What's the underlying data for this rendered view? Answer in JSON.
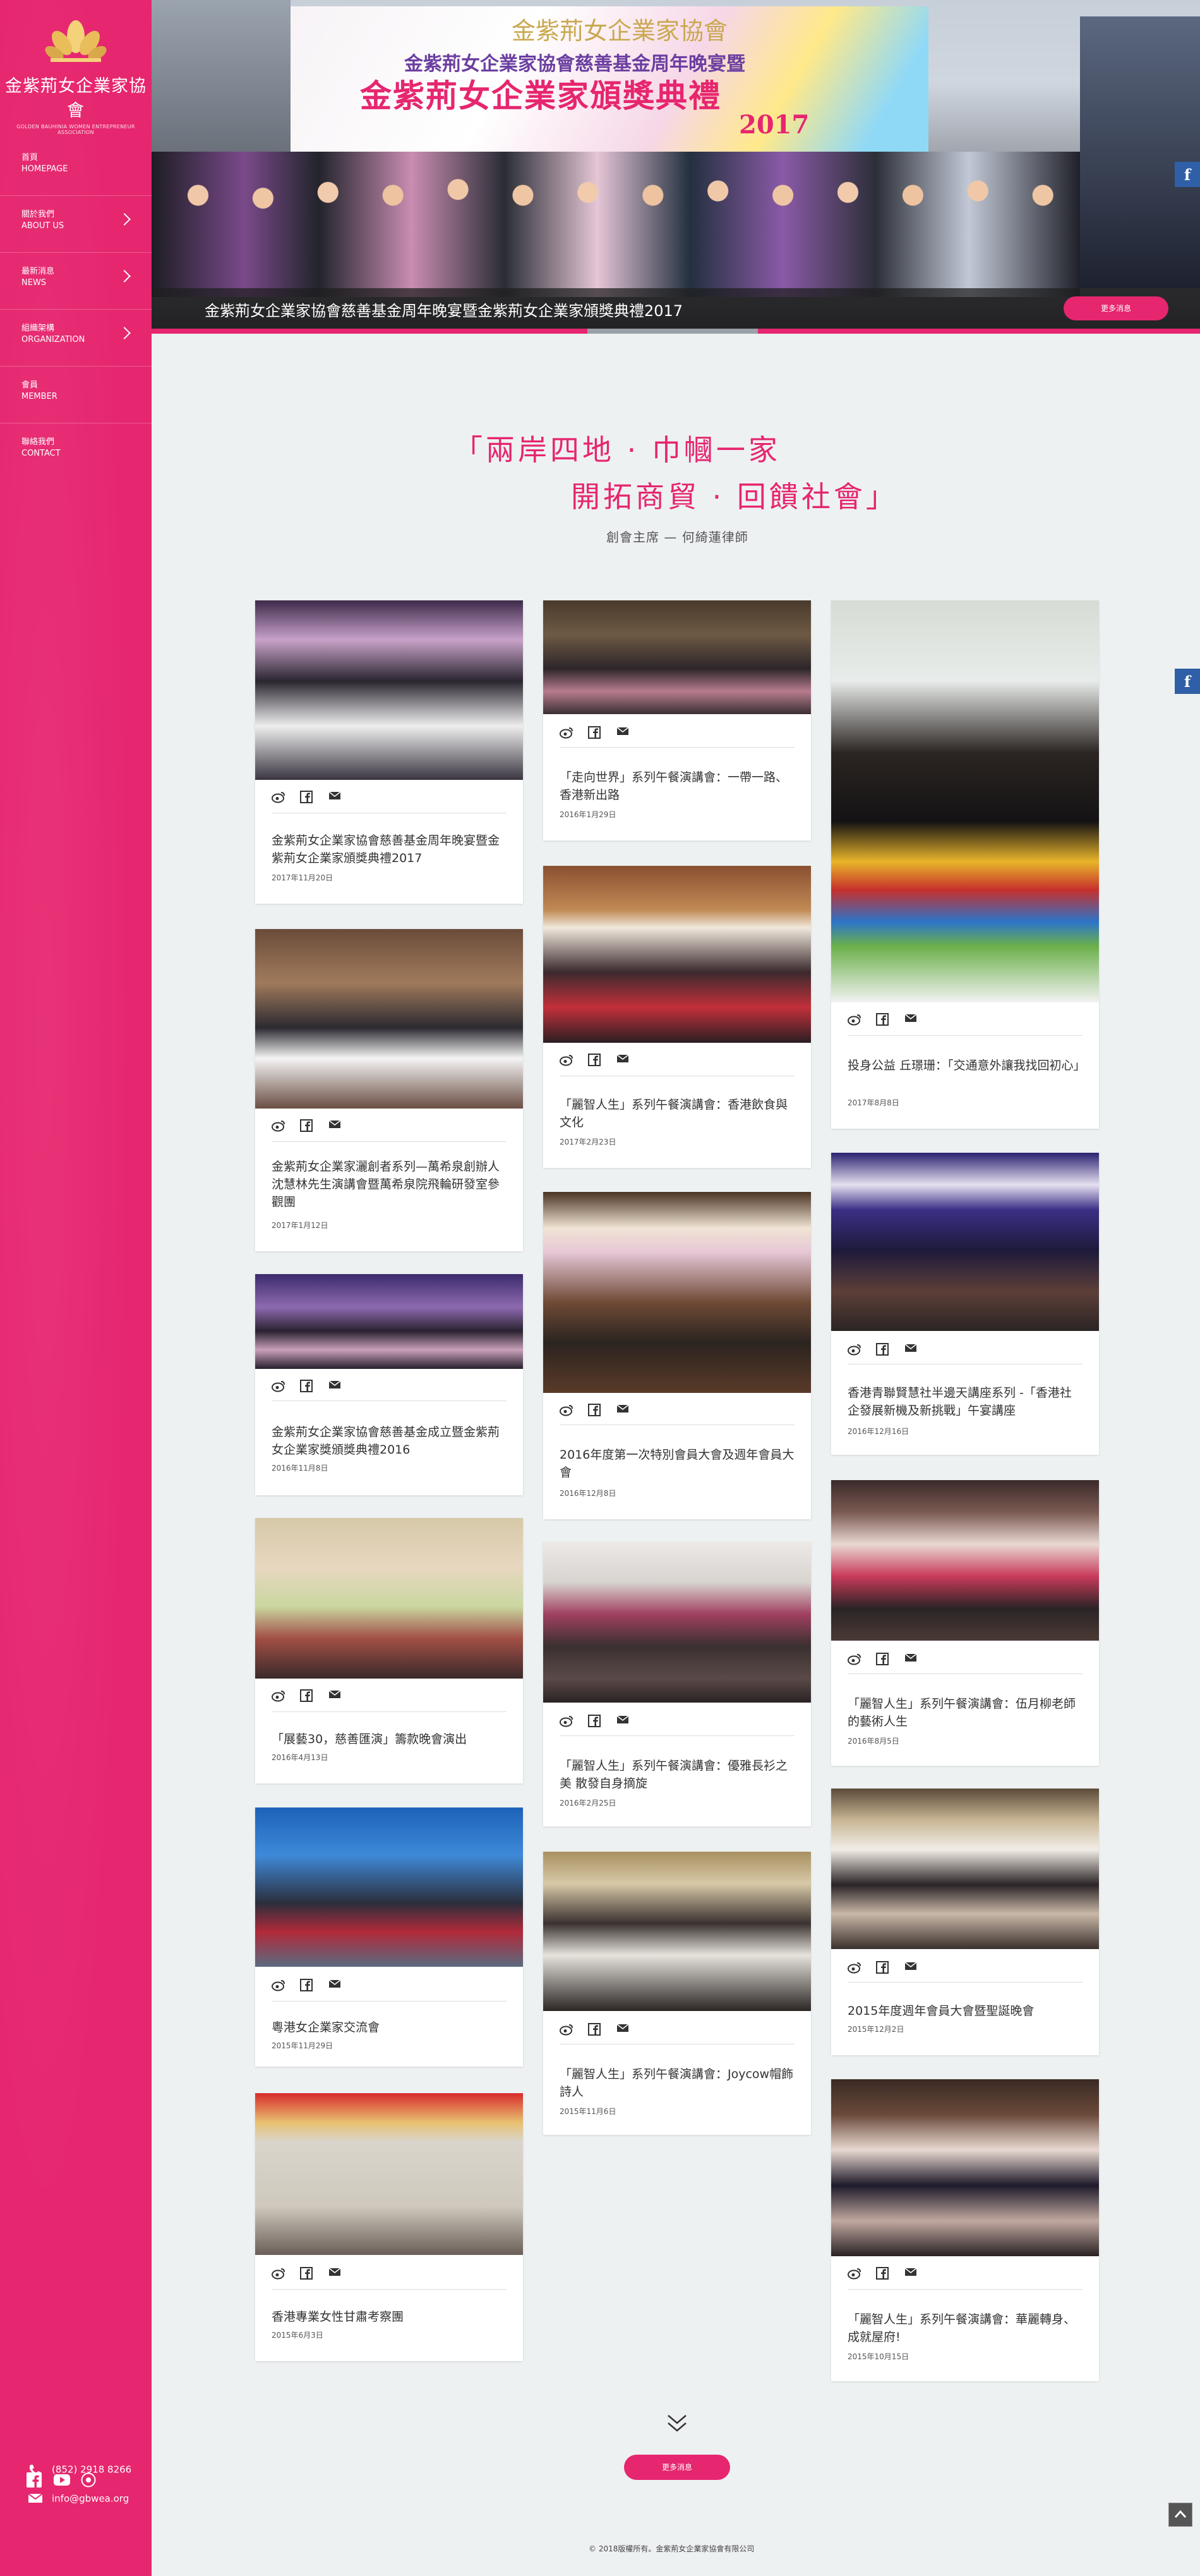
{
  "brand": {
    "name": "金紫荊女企業家協會",
    "subtitle": "GOLDEN BAUHINIA WOMEN ENTREPRENEUR ASSOCIATION"
  },
  "nav": [
    {
      "zh": "首頁",
      "en": "HOMEPAGE",
      "has_submenu": false
    },
    {
      "zh": "關於我們",
      "en": "ABOUT US",
      "has_submenu": true
    },
    {
      "zh": "最新消息",
      "en": "NEWS",
      "has_submenu": true
    },
    {
      "zh": "組織架構",
      "en": "ORGANIZATION",
      "has_submenu": true
    },
    {
      "zh": "會員",
      "en": "MEMBER",
      "has_submenu": false
    },
    {
      "zh": "聯絡我們",
      "en": "CONTACT",
      "has_submenu": false
    }
  ],
  "contact": {
    "phone": "(852) 2918 8266",
    "email": "info@gbwea.org"
  },
  "socials": [
    "facebook-icon",
    "youtube-icon",
    "play-icon"
  ],
  "hero": {
    "banner_line1": "金紫荊女企業家協會",
    "banner_line2": "金紫荊女企業家協會慈善基金周年晚宴暨",
    "banner_line3": "金紫荊女企業家頒獎典禮",
    "banner_year": "2017",
    "caption": "金紫荊女企業家協會慈善基金周年晚宴暨金紫荊女企業家頒獎典禮2017",
    "more_label": "更多消息"
  },
  "slogan": {
    "line1": "「兩岸四地 · 巾幗一家",
    "line2": "開拓商貿 · 回饋社會」",
    "author": "創會主席 — 何綺蓮律師"
  },
  "news": {
    "col1": [
      {
        "title": "金紫荊女企業家協會慈善基金周年晚宴暨金紫荊女企業家頒獎典禮2017",
        "date": "2017年11月20日"
      },
      {
        "title": "金紫荊女企業家灑創者系列—萬希泉創辦人沈慧林先生演講會暨萬希泉院飛輪研發室參觀團",
        "date": "2017年1月12日"
      },
      {
        "title": "金紫荊女企業家協會慈善基金成立暨金紫荊女企業家獎頒獎典禮2016",
        "date": "2016年11月8日"
      },
      {
        "title": "「展藝30，慈善匯演」籌款晚會演出",
        "date": "2016年4月13日"
      },
      {
        "title": "粵港女企業家交流會",
        "date": "2015年11月29日"
      },
      {
        "title": "香港專業女性甘肅考察團",
        "date": "2015年6月3日"
      }
    ],
    "col2": [
      {
        "title": "「走向世界」系列午餐演講會：一帶一路、香港新出路",
        "date": "2016年1月29日"
      },
      {
        "title": "「麗智人生」系列午餐演講會：香港飲食與文化",
        "date": "2017年2月23日"
      },
      {
        "title": "2016年度第一次特別會員大會及週年會員大會",
        "date": "2016年12月8日"
      },
      {
        "title": "「麗智人生」系列午餐演講會：優雅長衫之美 散發自身摘旋",
        "date": "2016年2月25日"
      },
      {
        "title": "「麗智人生」系列午餐演講會：Joycow帽飾詩人",
        "date": "2015年11月6日"
      }
    ],
    "col3": [
      {
        "title": "投身公益 丘璟珊：「交通意外讓我找回初心」",
        "date": "2017年8月8日"
      },
      {
        "title": "香港青聯賢慧社半邊天講座系列 -「香港社企發展新機及新挑戰」午宴講座",
        "date": "2016年12月16日"
      },
      {
        "title": "「麗智人生」系列午餐演講會：伍月柳老師的藝術人生",
        "date": "2016年8月5日"
      },
      {
        "title": "2015年度週年會員大會暨聖誕晚會",
        "date": "2015年12月2日"
      },
      {
        "title": "「麗智人生」系列午餐演講會：華麗轉身、成就屋府!",
        "date": "2015年10月15日"
      }
    ]
  },
  "bottom_more_label": "更多消息",
  "footer": "© 2018版權所有。金紫荊女企業家協會有限公司",
  "colors": {
    "brand_pink": "#e6266f",
    "background": "#eef1f2",
    "facebook_blue": "#2f5fa6"
  }
}
